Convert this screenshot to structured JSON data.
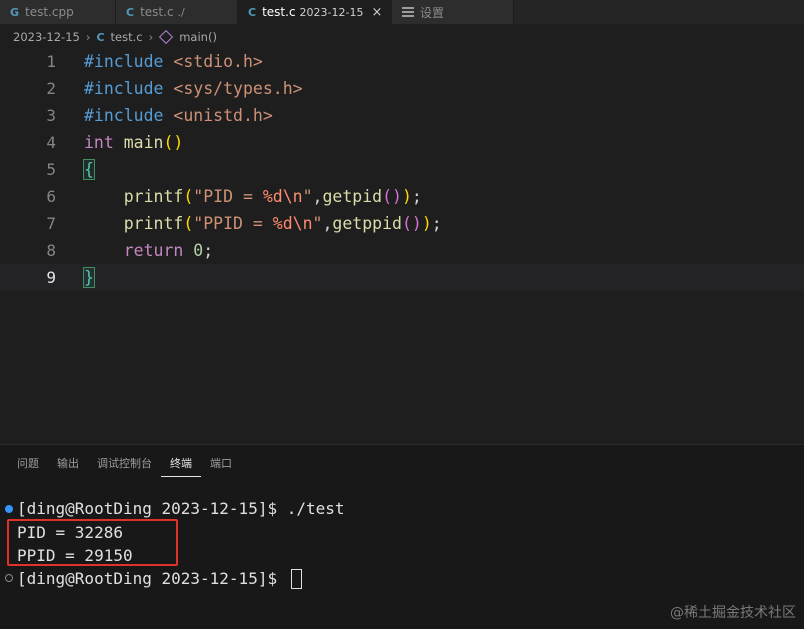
{
  "tabs": [
    {
      "icon": "cpp-file-icon",
      "icon_glyph": "G",
      "label": "test.cpp",
      "sub": ""
    },
    {
      "icon": "c-file-icon",
      "icon_glyph": "C",
      "label": "test.c",
      "sub": "./"
    },
    {
      "icon": "c-file-icon",
      "icon_glyph": "C",
      "label": "test.c",
      "sub": "2023-12-15",
      "close": "×",
      "active": true
    },
    {
      "icon": "settings-icon",
      "icon_glyph": "",
      "label": "设置",
      "sub": ""
    }
  ],
  "breadcrumb": {
    "folder": "2023-12-15",
    "file_glyph": "C",
    "file": "test.c",
    "symbol": "main()"
  },
  "editor": {
    "line_numbers": [
      "1",
      "2",
      "3",
      "4",
      "5",
      "6",
      "7",
      "8",
      "9"
    ],
    "current_line": 9,
    "lines": [
      {
        "include": "#include",
        "header": "<stdio.h>"
      },
      {
        "include": "#include",
        "header": "<sys/types.h>"
      },
      {
        "include": "#include",
        "header": "<unistd.h>"
      },
      {
        "type": "int",
        "func": "main",
        "paren": "()"
      },
      {
        "brace": "{"
      },
      {
        "indent": "    ",
        "func": "printf",
        "open": "(",
        "str_a": "\"PID = ",
        "fmt": "%d",
        "esc": "\\n",
        "str_b": "\"",
        "comma": ",",
        "call": "getpid",
        "inner": "()",
        "close": ")",
        "semi": ";"
      },
      {
        "indent": "    ",
        "func": "printf",
        "open": "(",
        "str_a": "\"PPID = ",
        "fmt": "%d",
        "esc": "\\n",
        "str_b": "\"",
        "comma": ",",
        "call": "getppid",
        "inner": "()",
        "close": ")",
        "semi": ";"
      },
      {
        "indent": "    ",
        "kw": "return",
        "num": "0",
        "semi": ";"
      },
      {
        "brace": "}"
      }
    ]
  },
  "panel": {
    "tabs": [
      "问题",
      "输出",
      "调试控制台",
      "终端",
      "端口"
    ],
    "active_tab": "终端"
  },
  "terminal": {
    "lines": [
      {
        "text": "[ding@RootDing 2023-12-15]$ ./test",
        "marker": "filled"
      },
      {
        "text": "PID = 32286",
        "marker": ""
      },
      {
        "text": "PPID = 29150",
        "marker": ""
      },
      {
        "text": "[ding@RootDing 2023-12-15]$ ",
        "marker": "hollow"
      }
    ]
  },
  "watermark": "@稀土掘金技术社区",
  "colors": {
    "highlight_box": "#e0312b",
    "accent": "#3794ff"
  }
}
